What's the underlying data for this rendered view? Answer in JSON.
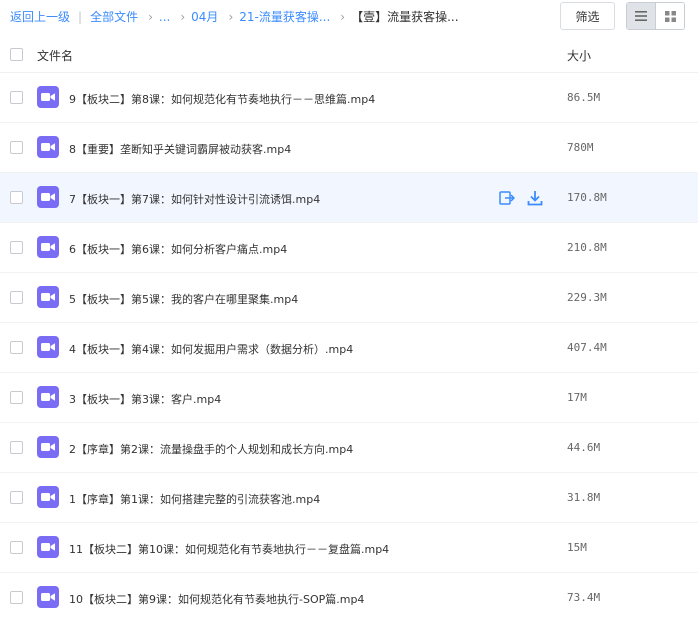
{
  "breadcrumb": {
    "back": "返回上一级",
    "root": "全部文件",
    "ellipsis": "...",
    "month": "04月",
    "folder": "21-流量获客操...",
    "current": "【壹】流量获客操..."
  },
  "toolbar": {
    "filter_label": "筛选",
    "view_list_icon": "list-view-icon",
    "view_grid_icon": "grid-view-icon"
  },
  "table": {
    "col_name": "文件名",
    "col_size": "大小"
  },
  "files": [
    {
      "name": "9【板块二】第8课：如何规范化有节奏地执行－－思维篇.mp4",
      "size": "86.5M"
    },
    {
      "name": "8【重要】垄断知乎关键词霸屏被动获客.mp4",
      "size": "780M"
    },
    {
      "name": "7【板块一】第7课：如何针对性设计引流诱饵.mp4",
      "size": "170.8M"
    },
    {
      "name": "6【板块一】第6课：如何分析客户痛点.mp4",
      "size": "210.8M"
    },
    {
      "name": "5【板块一】第5课：我的客户在哪里聚集.mp4",
      "size": "229.3M"
    },
    {
      "name": "4【板块一】第4课：如何发掘用户需求（数据分析）.mp4",
      "size": "407.4M"
    },
    {
      "name": "3【板块一】第3课：客户.mp4",
      "size": "17M"
    },
    {
      "name": "2【序章】第2课：流量操盘手的个人规划和成长方向.mp4",
      "size": "44.6M"
    },
    {
      "name": "1【序章】第1课：如何搭建完整的引流获客池.mp4",
      "size": "31.8M"
    },
    {
      "name": "11【板块二】第10课：如何规范化有节奏地执行－－复盘篇.mp4",
      "size": "15M"
    },
    {
      "name": "10【板块二】第9课：如何规范化有节奏地执行-SOP篇.mp4",
      "size": "73.4M"
    }
  ],
  "colors": {
    "accent": "#3b8cff",
    "video_icon": "#7b6cf6",
    "hover_row": "#f2f7ff"
  }
}
